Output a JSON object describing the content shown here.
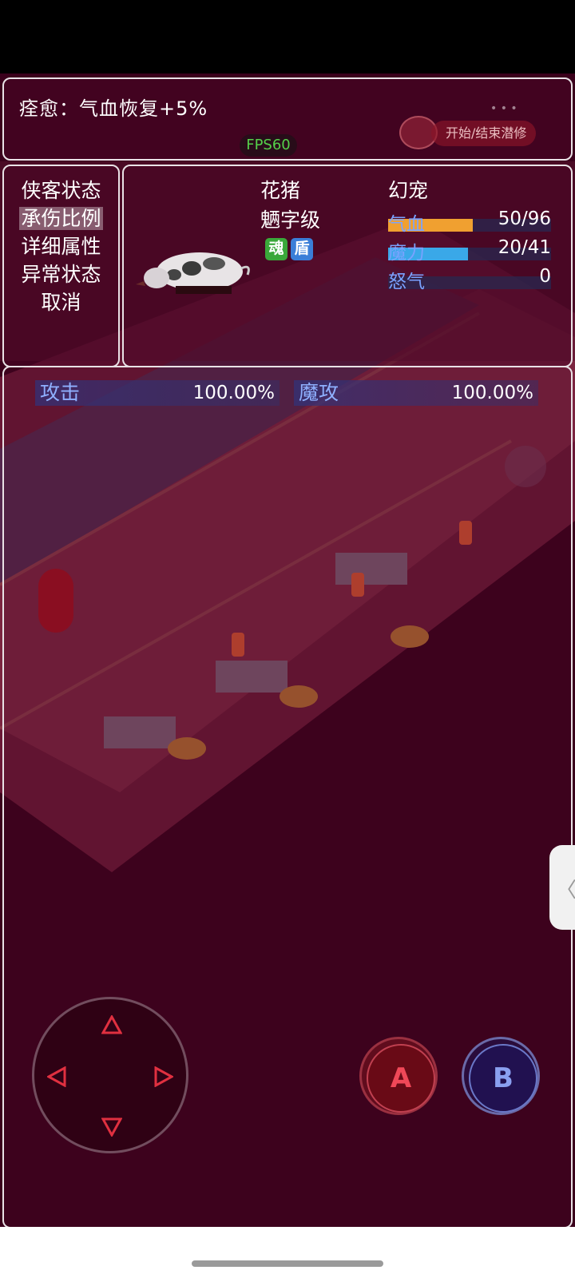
{
  "info": {
    "effect_text": "痊愈：气血恢复+5%",
    "fps": "FPS60",
    "stealth_button": "开始/结束潜修"
  },
  "menu": {
    "items": [
      "侠客状态",
      "承伤比例",
      "详细属性",
      "异常状态",
      "取消"
    ],
    "selected_index": 1
  },
  "pet": {
    "name": "花猪",
    "rank": "魉字级",
    "type": "幻宠",
    "badges": [
      {
        "label": "魂",
        "color": "#3aa83a"
      },
      {
        "label": "盾",
        "color": "#3a7ed8"
      }
    ],
    "stats": [
      {
        "label": "气血",
        "value": "50/96",
        "fill": 0.52,
        "color": "#f0a030"
      },
      {
        "label": "魔力",
        "value": "20/41",
        "fill": 0.49,
        "color": "#3aa8e8"
      },
      {
        "label": "怒气",
        "value": "0",
        "fill": 0,
        "color": "#888888"
      }
    ]
  },
  "attributes": [
    {
      "label": "攻击",
      "value": "100.00%"
    },
    {
      "label": "魔攻",
      "value": "100.00%"
    }
  ],
  "controls": {
    "a_label": "A",
    "b_label": "B",
    "a_color": "#c02828",
    "b_color": "#5a6ab8"
  },
  "side_handle": "〈"
}
